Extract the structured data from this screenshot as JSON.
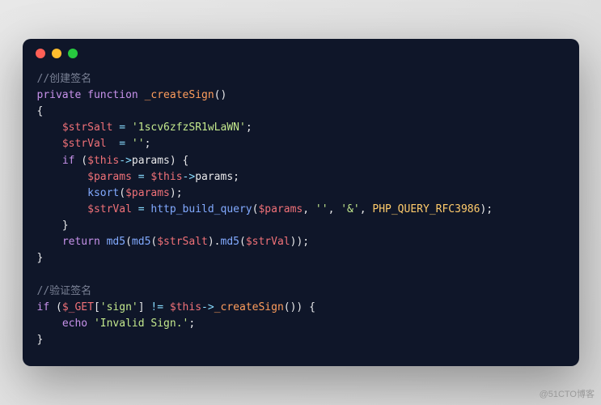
{
  "watermark": "@51CTO博客",
  "code": {
    "c1": "//创建签名",
    "l2_kw1": "private",
    "l2_kw2": "function",
    "l2_fn": "_createSign",
    "l2_paren": "()",
    "l3_brace": "{",
    "l4_var": "$strSalt",
    "l4_eq": " = ",
    "l4_str": "'1scv6zfzSR1wLaWN'",
    "l4_semi": ";",
    "l5_var": "$strVal",
    "l5_eq": "  = ",
    "l5_str": "''",
    "l5_semi": ";",
    "l6_kw": "if",
    "l6_op1": " (",
    "l6_var": "$this",
    "l6_arrow": "->",
    "l6_prop": "params",
    "l6_op2": ") {",
    "l7_var1": "$params",
    "l7_eq": " = ",
    "l7_var2": "$this",
    "l7_arrow": "->",
    "l7_prop": "params",
    "l7_semi": ";",
    "l8_fn": "ksort",
    "l8_op1": "(",
    "l8_var": "$params",
    "l8_op2": ");",
    "l9_var": "$strVal",
    "l9_eq": " = ",
    "l9_fn": "http_build_query",
    "l9_op1": "(",
    "l9_var2": "$params",
    "l9_c1": ", ",
    "l9_str1": "''",
    "l9_c2": ", ",
    "l9_str2": "'&'",
    "l9_c3": ", ",
    "l9_const": "PHP_QUERY_RFC3986",
    "l9_op2": ");",
    "l10_brace": "    }",
    "l11_kw": "return",
    "l11_sp": " ",
    "l11_fn1": "md5",
    "l11_op1": "(",
    "l11_fn2": "md5",
    "l11_op2": "(",
    "l11_var1": "$strSalt",
    "l11_op3": ").",
    "l11_fn3": "md5",
    "l11_op4": "(",
    "l11_var2": "$strVal",
    "l11_op5": "));",
    "l12_brace": "}",
    "c2": "//验证签名",
    "l14_kw": "if",
    "l14_op1": " (",
    "l14_var1": "$_GET",
    "l14_br1": "[",
    "l14_str": "'sign'",
    "l14_br2": "]",
    "l14_neq": " != ",
    "l14_var2": "$this",
    "l14_arrow": "->",
    "l14_fn": "_createSign",
    "l14_op2": "()) {",
    "l15_kw": "echo",
    "l15_sp": " ",
    "l15_str": "'Invalid Sign.'",
    "l15_semi": ";",
    "l16_brace": "}"
  }
}
